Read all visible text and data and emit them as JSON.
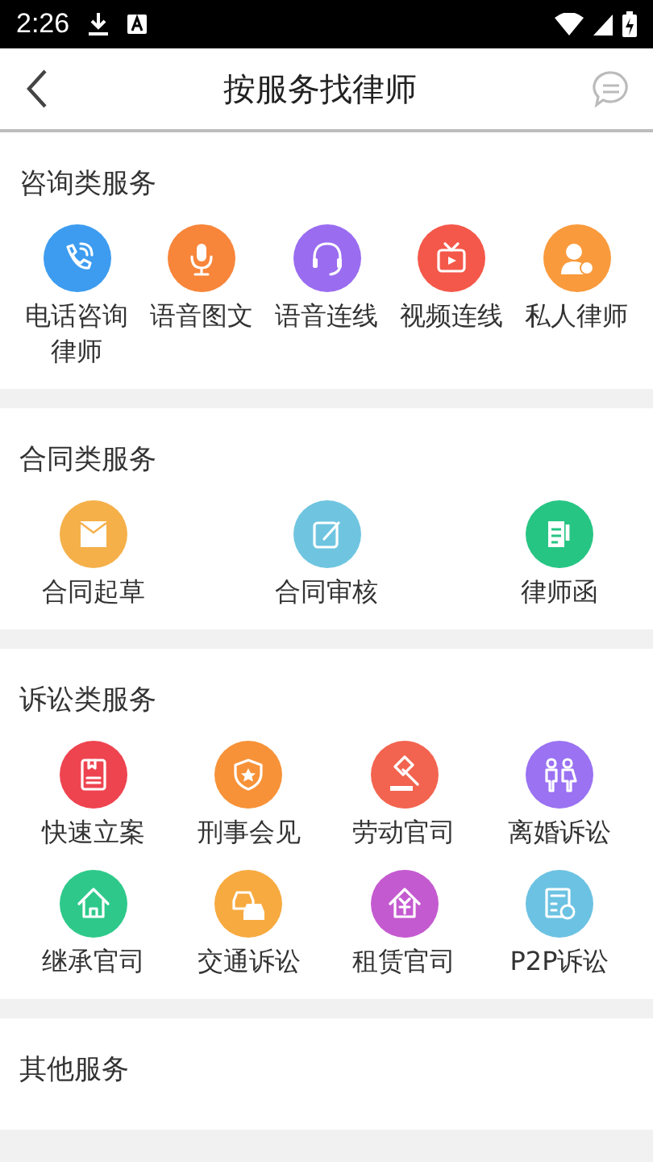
{
  "status_bar": {
    "time": "2:26"
  },
  "header": {
    "title": "按服务找律师"
  },
  "sections": [
    {
      "title": "咨询类服务",
      "items": [
        {
          "label": "电话咨询律师",
          "color": "#3d9cf0"
        },
        {
          "label": "语音图文",
          "color": "#f7853a"
        },
        {
          "label": "语音连线",
          "color": "#9a6cf0"
        },
        {
          "label": "视频连线",
          "color": "#f4584a"
        },
        {
          "label": "私人律师",
          "color": "#f99a3c"
        }
      ]
    },
    {
      "title": "合同类服务",
      "items": [
        {
          "label": "合同起草",
          "color": "#f5b04a"
        },
        {
          "label": "合同审核",
          "color": "#6fc5e0"
        },
        {
          "label": "律师函",
          "color": "#27c584"
        }
      ]
    },
    {
      "title": "诉讼类服务",
      "items": [
        {
          "label": "快速立案",
          "color": "#ee4450"
        },
        {
          "label": "刑事会见",
          "color": "#f79238"
        },
        {
          "label": "劳动官司",
          "color": "#f26450"
        },
        {
          "label": "离婚诉讼",
          "color": "#9a72f2"
        },
        {
          "label": "继承官司",
          "color": "#2ec98a"
        },
        {
          "label": "交通诉讼",
          "color": "#f7aa40"
        },
        {
          "label": "租赁官司",
          "color": "#c45ad0"
        },
        {
          "label": "P2P诉讼",
          "color": "#6cc2e2"
        }
      ]
    },
    {
      "title": "其他服务"
    }
  ]
}
